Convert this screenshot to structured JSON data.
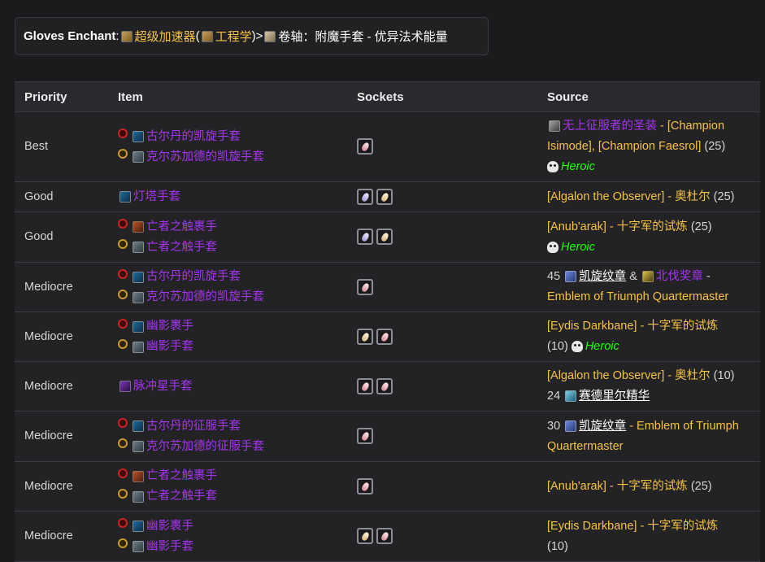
{
  "enchant": {
    "label": "Gloves Enchant",
    "colon": ":",
    "name": "超级加速器",
    "paren_open": " (",
    "profession": "工程学",
    "paren_close": ")",
    "arrow": " > ",
    "scroll": "卷轴：附魔手套 - 优异法术能量"
  },
  "table": {
    "headers": [
      "Priority",
      "Item",
      "Sockets",
      "Source"
    ],
    "rows": [
      {
        "priority": "Best",
        "items": [
          {
            "faction": "horde",
            "icon": "glove-blue",
            "name": "古尔丹的凯旋手套"
          },
          {
            "faction": "alliance",
            "icon": "glove-gray",
            "name": "克尔苏加德的凯旋手套"
          }
        ],
        "sockets": [
          "red"
        ],
        "source": {
          "icon": "armor",
          "epic": "无上征服者的圣装",
          "gold": " - [Champion Isimode], [Champion Faesrol]",
          "plain": " (25)",
          "heroic": "Heroic"
        }
      },
      {
        "priority": "Good",
        "items": [
          {
            "faction": "",
            "icon": "glove-blue",
            "name": "灯塔手套"
          }
        ],
        "sockets": [
          "blue",
          "yellow"
        ],
        "source": {
          "gold": "[Algalon the Observer] - 奥杜尔",
          "plain": " (25)"
        }
      },
      {
        "priority": "Good",
        "items": [
          {
            "faction": "horde",
            "icon": "glove-red",
            "name": "亡者之触裹手"
          },
          {
            "faction": "alliance",
            "icon": "glove-gray",
            "name": "亡者之触手套"
          }
        ],
        "sockets": [
          "blue",
          "yellow"
        ],
        "source": {
          "gold": "[Anub'arak] - 十字军的试炼",
          "plain": " (25)",
          "heroic": "Heroic"
        }
      },
      {
        "priority": "Mediocre",
        "items": [
          {
            "faction": "horde",
            "icon": "glove-blue",
            "name": "古尔丹的凯旋手套"
          },
          {
            "faction": "alliance",
            "icon": "glove-gray",
            "name": "克尔苏加德的凯旋手套"
          }
        ],
        "sockets": [
          "red"
        ],
        "source": {
          "count": "45",
          "badge1": "凯旋纹章",
          "amp": " & ",
          "badge2": "北伐奖章",
          "dash": " -",
          "tail": "Emblem of Triumph Quartermaster"
        }
      },
      {
        "priority": "Mediocre",
        "items": [
          {
            "faction": "horde",
            "icon": "glove-blue",
            "name": "幽影裹手"
          },
          {
            "faction": "alliance",
            "icon": "glove-gray",
            "name": "幽影手套"
          }
        ],
        "sockets": [
          "yellow",
          "red"
        ],
        "source": {
          "gold": "[Eydis Darkbane] - 十字军的试炼",
          "plain": "(10)",
          "heroic": "Heroic"
        }
      },
      {
        "priority": "Mediocre",
        "items": [
          {
            "faction": "",
            "icon": "glove-purple",
            "name": "脉冲星手套"
          }
        ],
        "sockets": [
          "red",
          "red"
        ],
        "source": {
          "gold": "[Algalon the Observer] - 奥杜尔",
          "plain": " (10)",
          "count": "24",
          "crystal": "赛德里尔精华"
        }
      },
      {
        "priority": "Mediocre",
        "items": [
          {
            "faction": "horde",
            "icon": "glove-blue",
            "name": "古尔丹的征服手套"
          },
          {
            "faction": "alliance",
            "icon": "glove-gray",
            "name": "克尔苏加德的征服手套"
          }
        ],
        "sockets": [
          "red"
        ],
        "source": {
          "count": "30",
          "badge1": "凯旋纹章",
          "tail": " - Emblem of Triumph Quartermaster"
        }
      },
      {
        "priority": "Mediocre",
        "items": [
          {
            "faction": "horde",
            "icon": "glove-red",
            "name": "亡者之触裹手"
          },
          {
            "faction": "alliance",
            "icon": "glove-gray",
            "name": "亡者之触手套"
          }
        ],
        "sockets": [
          "red"
        ],
        "source": {
          "gold": "[Anub'arak] - 十字军的试炼",
          "plain": " (25)"
        }
      },
      {
        "priority": "Mediocre",
        "items": [
          {
            "faction": "horde",
            "icon": "glove-blue",
            "name": "幽影裹手"
          },
          {
            "faction": "alliance",
            "icon": "glove-gray",
            "name": "幽影手套"
          }
        ],
        "sockets": [
          "yellow",
          "red"
        ],
        "source": {
          "gold": "[Eydis Darkbane] - 十字军的试炼",
          "plain": "(10)"
        }
      }
    ]
  }
}
